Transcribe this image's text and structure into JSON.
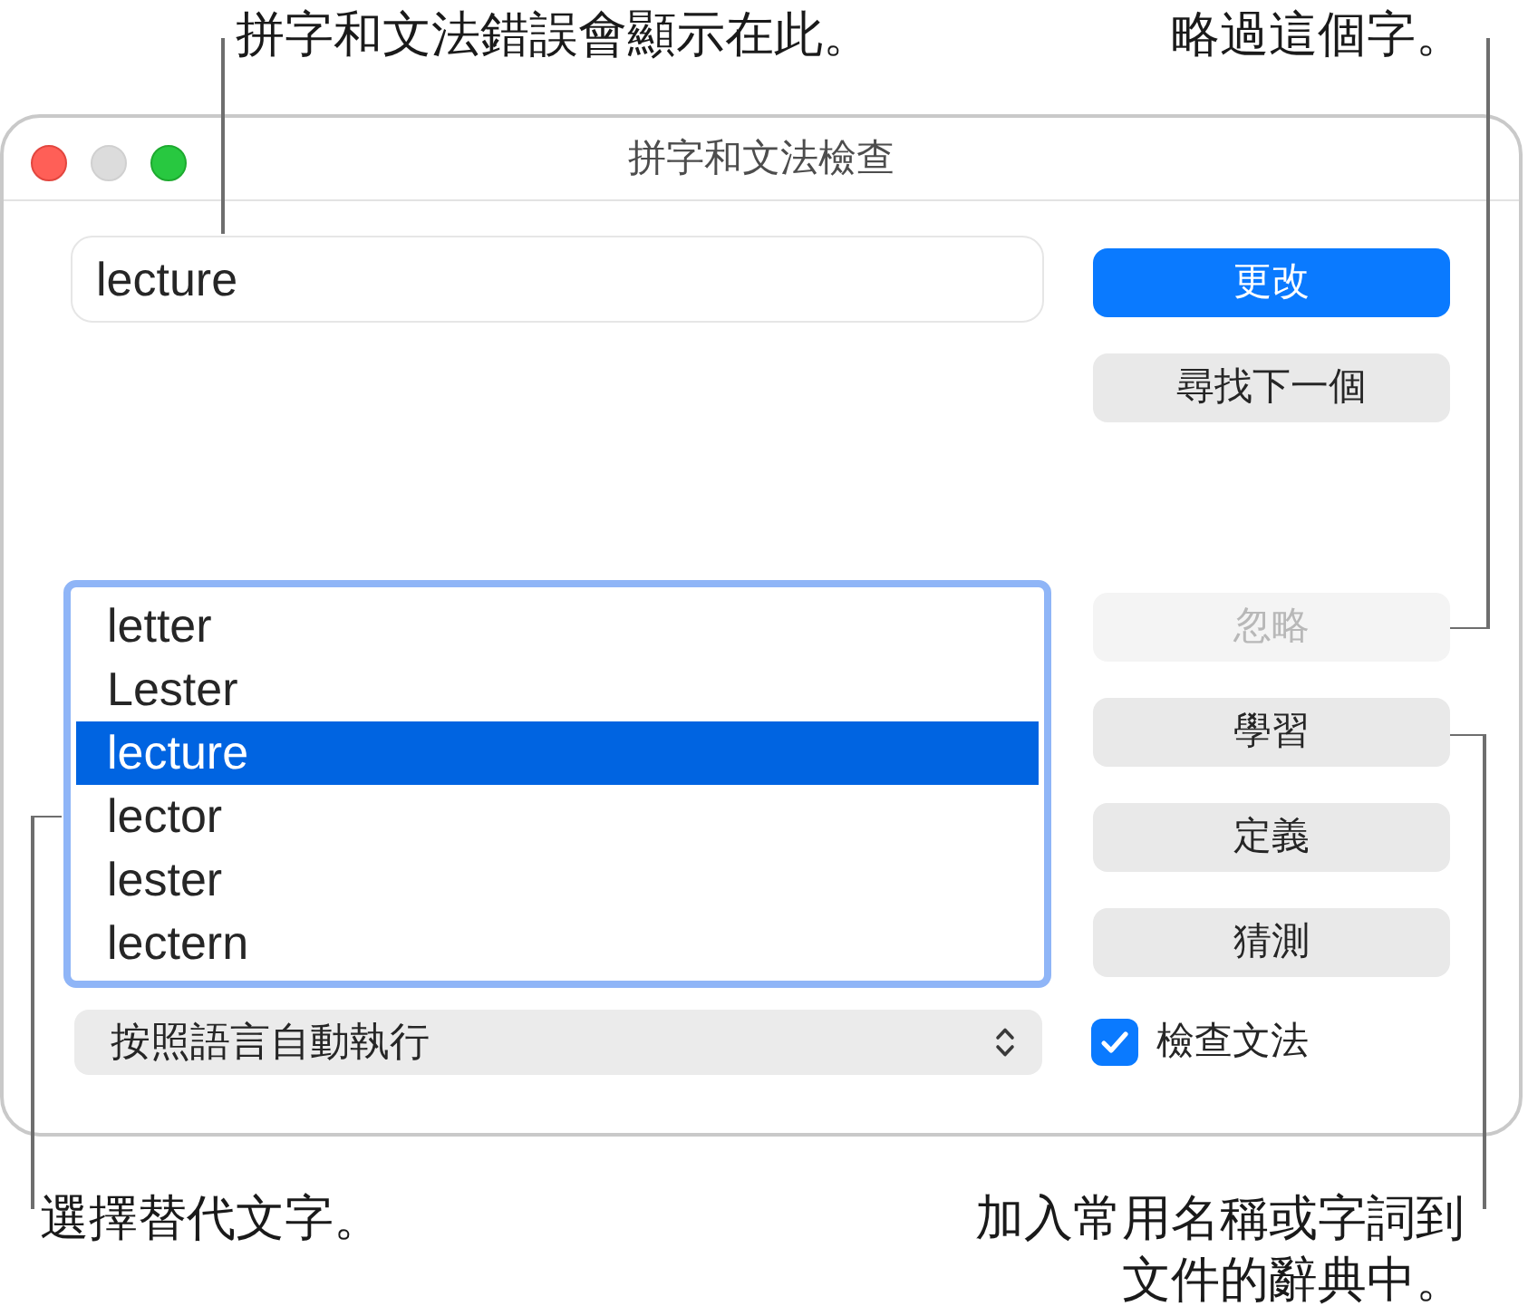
{
  "callouts": [
    {
      "text": "拼字和文法錯誤會顯示在此。"
    },
    {
      "text": "略過這個字。"
    },
    {
      "text": "選擇替代文字。"
    },
    {
      "text": "加入常用名稱或字詞到文件的辭典中。"
    }
  ],
  "window": {
    "title": "拼字和文法檢查"
  },
  "word_field": {
    "value": "lecture"
  },
  "upper_buttons": [
    {
      "label": "更改",
      "kind": "default",
      "disabled": false
    },
    {
      "label": "尋找下一個",
      "kind": "push",
      "disabled": false
    }
  ],
  "suggestions": [
    {
      "label": "letter",
      "selected": false
    },
    {
      "label": "Lester",
      "selected": false
    },
    {
      "label": "lecture",
      "selected": true
    },
    {
      "label": "lector",
      "selected": false
    },
    {
      "label": "lester",
      "selected": false
    },
    {
      "label": "lectern",
      "selected": false
    }
  ],
  "lower_buttons": [
    {
      "label": "忽略",
      "kind": "push",
      "disabled": true
    },
    {
      "label": "學習",
      "kind": "push",
      "disabled": false
    },
    {
      "label": "定義",
      "kind": "push",
      "disabled": false
    },
    {
      "label": "猜測",
      "kind": "push",
      "disabled": false
    }
  ],
  "language_popup": {
    "value": "按照語言自動執行"
  },
  "grammar_checkbox": {
    "label": "檢查文法",
    "checked": true
  }
}
